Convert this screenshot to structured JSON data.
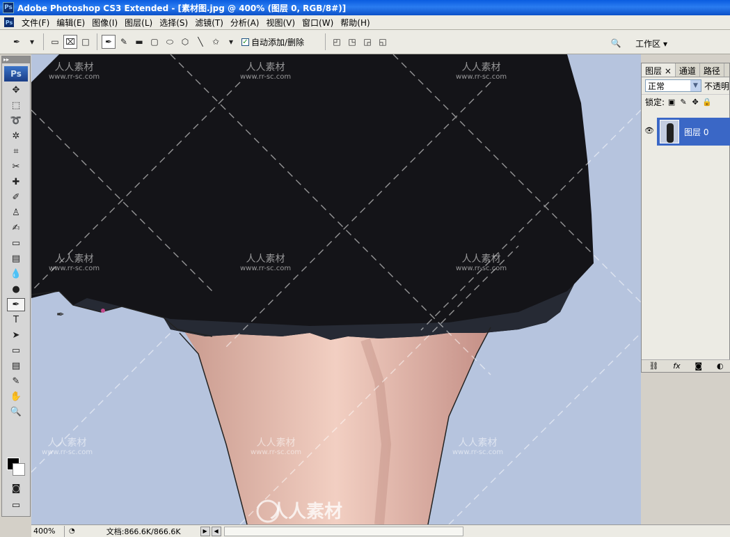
{
  "window": {
    "title": "Adobe Photoshop CS3 Extended - [素材图.jpg @ 400% (图层 0, RGB/8#)]",
    "app_icon": "Ps"
  },
  "menu": [
    "文件(F)",
    "编辑(E)",
    "图像(I)",
    "图层(L)",
    "选择(S)",
    "滤镜(T)",
    "分析(A)",
    "视图(V)",
    "窗口(W)",
    "帮助(H)"
  ],
  "options_bar": {
    "auto_add_delete_label": "自动添加/删除",
    "auto_add_delete_checked": true,
    "workspace_label": "工作区 ▾"
  },
  "toolbox": {
    "logo": "Ps",
    "text_tool_glyph": "T"
  },
  "canvas": {
    "watermark_text": "人人素材",
    "watermark_url": "www.rr-sc.com",
    "bottom_logo": "人人素材"
  },
  "layers_panel": {
    "tabs": [
      "图层 ×",
      "通道",
      "路径"
    ],
    "blend_mode": "正常",
    "opacity_label": "不透明",
    "lock_label": "锁定:",
    "layer_name": "图层 0",
    "footer_icons": [
      "link-icon",
      "fx-icon",
      "mask-icon",
      "adjustment-icon"
    ]
  },
  "status_bar": {
    "zoom": "400%",
    "doc_size": "文档:866.6K/866.6K"
  },
  "colors": {
    "title_bar": "#0a5ce0",
    "canvas_bg": "#b6c4de",
    "layer_selected": "#3a67c6"
  }
}
